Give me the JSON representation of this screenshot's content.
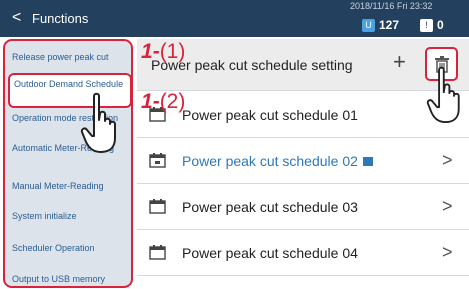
{
  "header": {
    "back_glyph": "<",
    "title": "Functions",
    "datetime": "2018/11/16 Fri 23:32",
    "count_blue": "127",
    "count_white": "0"
  },
  "sidebar": {
    "items": [
      {
        "label": "Release power peak cut"
      },
      {
        "label": "Outdoor Demand Schedule",
        "selected": true
      },
      {
        "label": "Operation mode restriction"
      },
      {
        "label": "Automatic Meter-Reading"
      },
      {
        "label": "Manual Meter-Reading"
      },
      {
        "label": "System initialize"
      },
      {
        "label": "Scheduler Operation"
      },
      {
        "label": "Output to USB memory"
      }
    ]
  },
  "main": {
    "header_label": "Power peak cut schedule setting",
    "add_glyph": "+",
    "schedules": [
      {
        "label": "Power peak cut schedule 01"
      },
      {
        "label": "Power peak cut schedule 02",
        "active": true
      },
      {
        "label": "Power peak cut schedule 03"
      },
      {
        "label": "Power peak cut schedule 04"
      }
    ],
    "chevron": ">"
  },
  "annotations": {
    "a1": {
      "step": "1",
      "dash": "-",
      "sub": "(1)"
    },
    "a2": {
      "step": "1",
      "dash": "-",
      "sub": "(2)"
    }
  },
  "colors": {
    "topbar": "#23415f",
    "highlight": "#d9233c",
    "link": "#2b5d93",
    "active": "#2e78b8"
  }
}
